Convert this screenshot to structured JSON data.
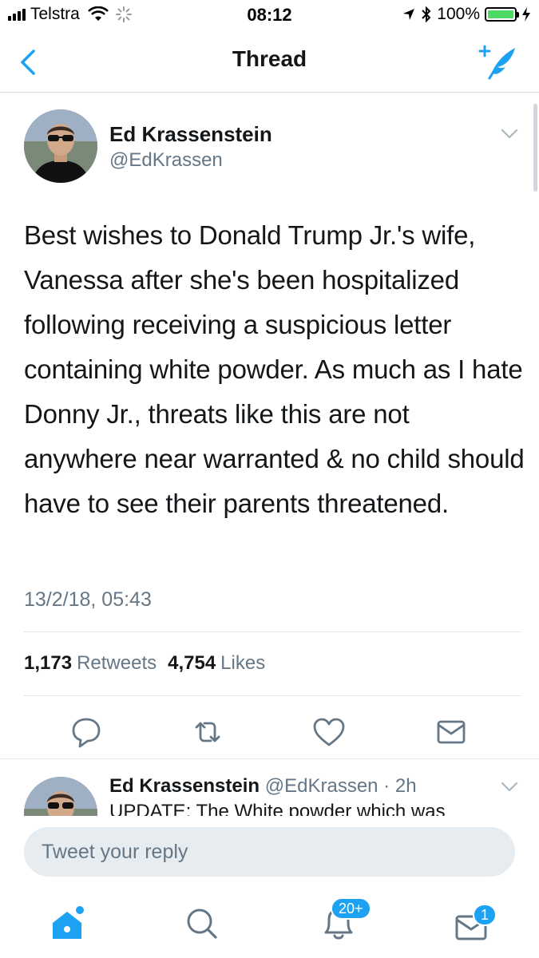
{
  "status_bar": {
    "carrier": "Telstra",
    "time": "08:12",
    "battery": "100%",
    "battery_level": 1.0
  },
  "nav": {
    "title": "Thread",
    "back_icon": "chevron-left-icon",
    "compose_icon": "compose-tweet-icon"
  },
  "tweet": {
    "author_name": "Ed Krassenstein",
    "author_handle": "@EdKrassen",
    "text": "Best wishes to Donald Trump Jr.'s wife, Vanessa after she's been hospitalized following receiving a suspicious letter containing white powder. As much as I hate Donny Jr., threats like this are not anywhere near warranted & no child should have to see their parents threatened.",
    "timestamp": "13/2/18, 05:43",
    "retweets_count": "1,173",
    "retweets_label": "Retweets",
    "likes_count": "4,754",
    "likes_label": "Likes",
    "actions": [
      "reply-icon",
      "retweet-icon",
      "like-icon",
      "direct-message-icon"
    ]
  },
  "reply_tweet": {
    "author_name": "Ed Krassenstein",
    "meta": "@EdKrassen · 2h",
    "text": "UPDATE: The White powder which was"
  },
  "composer": {
    "placeholder": "Tweet your reply"
  },
  "tab_bar": {
    "items": [
      "home-icon",
      "search-icon",
      "notifications-icon",
      "messages-icon"
    ],
    "notifications_badge": "20+",
    "messages_badge": "1"
  },
  "colors": {
    "accent": "#1da1f2",
    "text": "#14171a",
    "secondary_text": "#657786",
    "divider": "#e1e8ed",
    "battery": "#4cd964"
  }
}
